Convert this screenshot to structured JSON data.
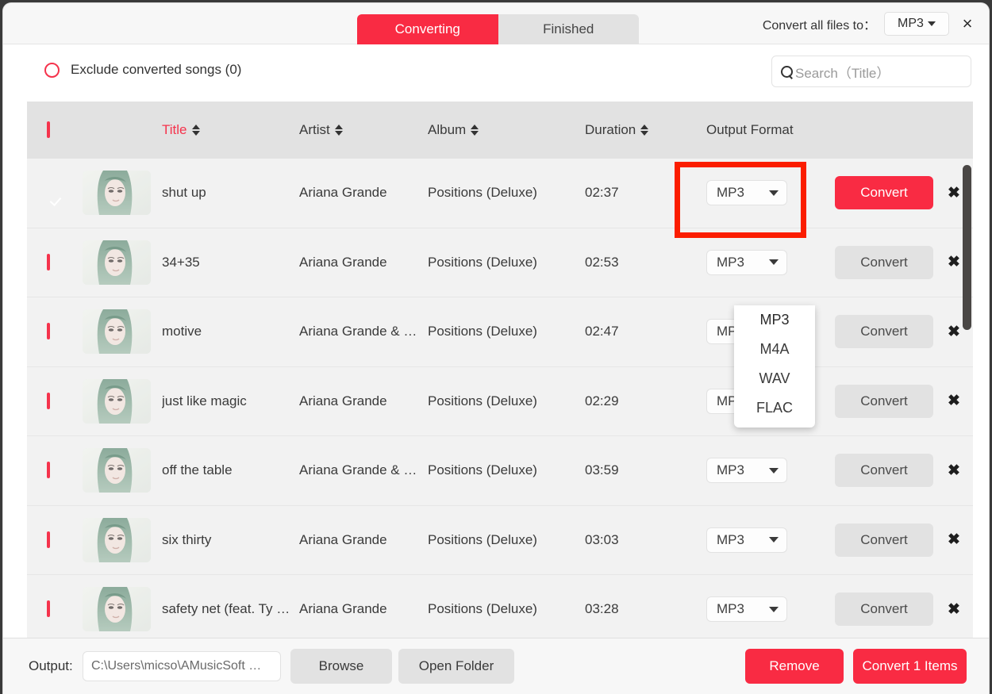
{
  "topbar": {
    "tabs": [
      {
        "label": "Converting",
        "active": true
      },
      {
        "label": "Finished",
        "active": false
      }
    ],
    "convert_all_label": "Convert all files to：",
    "convert_all_value": "MP3",
    "close_label": "×"
  },
  "filter": {
    "exclude_label": "Exclude converted songs (0)",
    "search_placeholder": "Search（Title）"
  },
  "table": {
    "headers": {
      "title": "Title",
      "artist": "Artist",
      "album": "Album",
      "duration": "Duration",
      "output_format": "Output Format"
    },
    "rows": [
      {
        "checked": true,
        "title": "shut up",
        "artist": "Ariana Grande",
        "album": "Positions (Deluxe)",
        "duration": "02:37",
        "format": "MP3",
        "convert_label": "Convert",
        "convert_state": "primary",
        "remove_label": "✖"
      },
      {
        "checked": false,
        "title": "34+35",
        "artist": "Ariana Grande",
        "album": "Positions (Deluxe)",
        "duration": "02:53",
        "format": "MP3",
        "convert_label": "Convert",
        "convert_state": "muted",
        "remove_label": "✖"
      },
      {
        "checked": false,
        "title": "motive",
        "artist": "Ariana Grande & …",
        "album": "Positions (Deluxe)",
        "duration": "02:47",
        "format": "MP3",
        "convert_label": "Convert",
        "convert_state": "muted",
        "remove_label": "✖"
      },
      {
        "checked": false,
        "title": "just like magic",
        "artist": "Ariana Grande",
        "album": "Positions (Deluxe)",
        "duration": "02:29",
        "format": "MP3",
        "convert_label": "Convert",
        "convert_state": "muted",
        "remove_label": "✖"
      },
      {
        "checked": false,
        "title": "off the table",
        "artist": "Ariana Grande & …",
        "album": "Positions (Deluxe)",
        "duration": "03:59",
        "format": "MP3",
        "convert_label": "Convert",
        "convert_state": "muted",
        "remove_label": "✖"
      },
      {
        "checked": false,
        "title": "six thirty",
        "artist": "Ariana Grande",
        "album": "Positions (Deluxe)",
        "duration": "03:03",
        "format": "MP3",
        "convert_label": "Convert",
        "convert_state": "muted",
        "remove_label": "✖"
      },
      {
        "checked": false,
        "title": "safety net (feat. Ty …",
        "artist": "Ariana Grande",
        "album": "Positions (Deluxe)",
        "duration": "03:28",
        "format": "MP3",
        "convert_label": "Convert",
        "convert_state": "muted",
        "remove_label": "✖"
      }
    ]
  },
  "dropdown": {
    "open": true,
    "options": [
      "MP3",
      "M4A",
      "WAV",
      "FLAC"
    ],
    "selected": "MP3"
  },
  "bottom": {
    "output_label": "Output:",
    "output_path": "C:\\Users\\micso\\AMusicSoft …",
    "browse_label": "Browse",
    "open_folder_label": "Open Folder",
    "remove_label": "Remove",
    "convert_items_label": "Convert 1 Items"
  },
  "colors": {
    "accent_red": "#f92b43",
    "annotation_red": "#fb1d00",
    "header_grey": "#e2e2e2",
    "row_grey": "#f2f2f2"
  }
}
